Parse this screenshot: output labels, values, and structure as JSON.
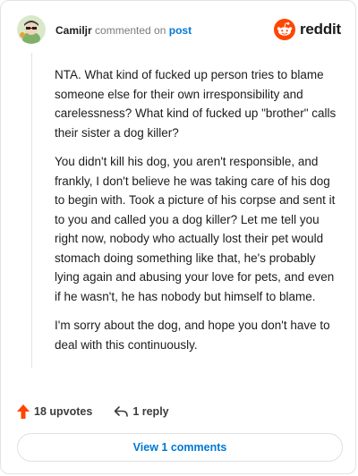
{
  "comment": {
    "username": "Camiljr",
    "action_text": "commented on",
    "post_link": "post",
    "paragraphs": [
      "NTA. What kind of fucked up person tries to blame someone else for their own irresponsibility and carelessness? What kind of fucked up \"brother\" calls their sister a dog killer?",
      "You didn't kill his dog, you aren't responsible, and frankly, I don't believe he was taking care of his dog to begin with. Took a picture of his corpse and sent it to you and called you a dog killer? Let me tell you right now, nobody who actually lost their pet would stomach doing something like that, he's probably lying again and abusing your love for pets, and even if he wasn't, he has nobody but himself to blame.",
      "I'm sorry about the dog, and hope you don't have to deal with this continuously."
    ]
  },
  "brand": {
    "name": "reddit",
    "color": "#ff4500"
  },
  "actions": {
    "upvotes_label": "18 upvotes",
    "reply_label": "1 reply"
  },
  "view_button_label": "View 1 comments",
  "colors": {
    "accent": "#0079d3",
    "upvote": "#ff4500"
  }
}
